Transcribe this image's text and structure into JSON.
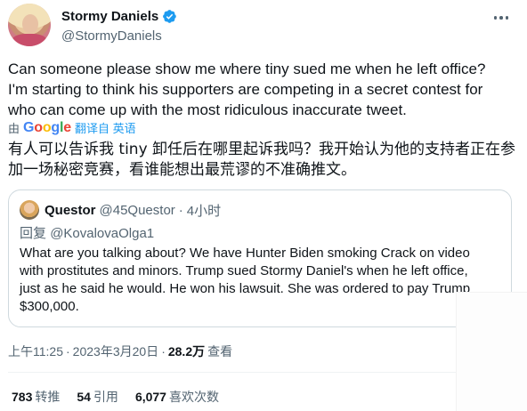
{
  "author": {
    "name": "Stormy Daniels",
    "handle": "@StormyDaniels",
    "verified": true,
    "avatar_icon": "profile-photo",
    "more_icon": "more-dots-icon"
  },
  "tweet": {
    "lines": [
      "Can someone please show me where tiny sued me when he left office?",
      "I'm starting to think his supporters are competing in a secret contest for",
      "who can come up with the most ridiculous inaccurate tweet."
    ]
  },
  "translation": {
    "by": "由",
    "google_letters": [
      "G",
      "o",
      "o",
      "g",
      "l",
      "e"
    ],
    "translated_from": "翻译自 英语",
    "lines": [
      "有人可以告诉我 tiny 卸任后在哪里起诉我吗？我开始认为他的支持者正在参",
      "加一场秘密竞赛，看谁能想出最荒谬的不准确推文。"
    ]
  },
  "quote": {
    "name": "Questor",
    "handle": "@45Questor",
    "separator": "·",
    "time": "4小时",
    "reply_prefix": "回复",
    "reply_to": "@KovalovaOlga1",
    "lines": [
      "What are you talking about? We have Hunter Biden smoking Crack on video",
      "with prostitutes and minors. Trump sued Stormy Daniel's when he left office,",
      "just as he said he would. He won his lawsuit. She was ordered to pay Trump",
      "$300,000."
    ]
  },
  "meta": {
    "time": "上午11:25",
    "separator": "·",
    "date": "2023年3月20日",
    "separator2": "·",
    "views": "28.2万",
    "views_label": "查看"
  },
  "stats": [
    {
      "count": "783",
      "label": "转推"
    },
    {
      "count": "54",
      "label": "引用"
    },
    {
      "count": "6,077",
      "label": "喜欢次数"
    }
  ],
  "colors": {
    "text": "#0f1419",
    "secondary": "#536471",
    "link": "#1d9bf0",
    "border": "#cfd9de"
  }
}
